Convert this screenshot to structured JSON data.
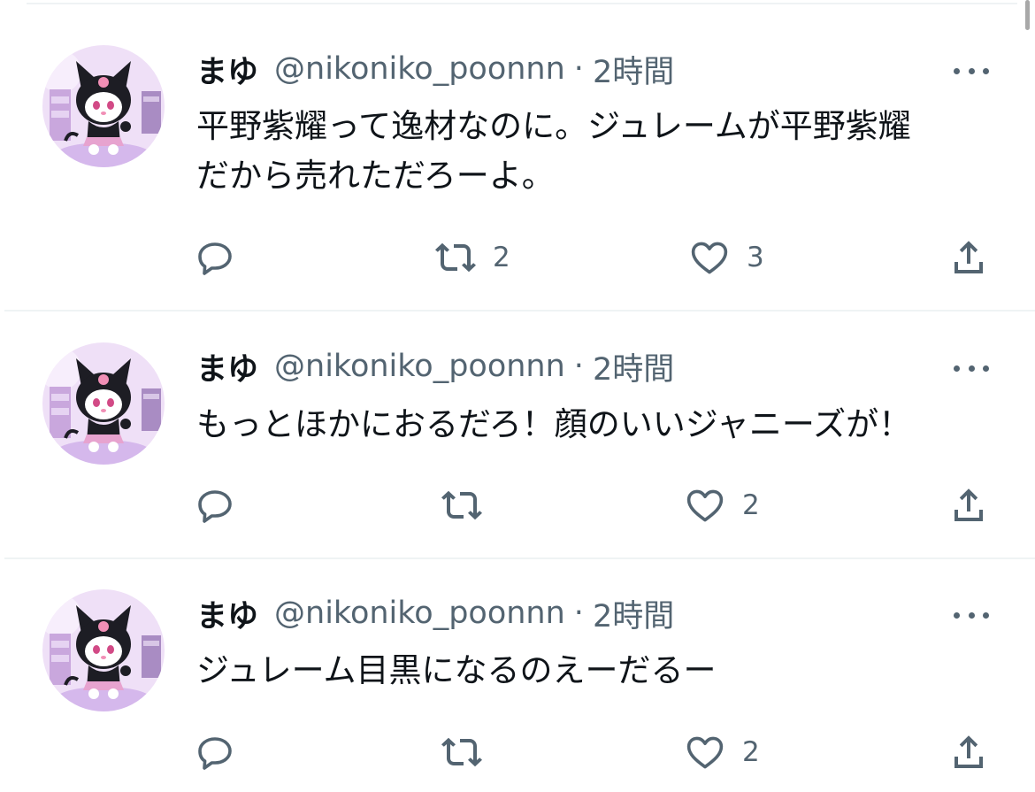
{
  "tweets": [
    {
      "name": "まゆ",
      "handle": "@nikoniko_poonnn",
      "separator": "·",
      "time": "2時間",
      "lines": [
        "平野紫耀って逸材なのに。ジュレームが平野紫耀",
        "だから売れただろーよ。"
      ],
      "actions": {
        "reply_icon": "reply-icon",
        "retweet_icon": "retweet-icon",
        "retweets": "2",
        "like_icon": "heart-icon",
        "likes": "3",
        "share_icon": "share-icon"
      }
    },
    {
      "name": "まゆ",
      "handle": "@nikoniko_poonnn",
      "separator": "·",
      "time": "2時間",
      "lines": [
        "もっとほかにおるだろ！顔のいいジャニーズが！"
      ],
      "actions": {
        "reply_icon": "reply-icon",
        "retweet_icon": "retweet-icon",
        "retweets": "",
        "like_icon": "heart-icon",
        "likes": "2",
        "share_icon": "share-icon"
      }
    },
    {
      "name": "まゆ",
      "handle": "@nikoniko_poonnn",
      "separator": "·",
      "time": "2時間",
      "lines": [
        "ジュレーム目黒になるのえーだるー"
      ],
      "actions": {
        "reply_icon": "reply-icon",
        "retweet_icon": "retweet-icon",
        "retweets": "",
        "like_icon": "heart-icon",
        "likes": "2",
        "share_icon": "share-icon"
      }
    }
  ],
  "colors": {
    "text": "#0f1419",
    "secondary": "#536471",
    "divider": "#eff3f4",
    "avatar_bg": "#efe0f7"
  },
  "avatar_icon": "kuromi-avatar-icon",
  "more_icon": "more-options-icon"
}
